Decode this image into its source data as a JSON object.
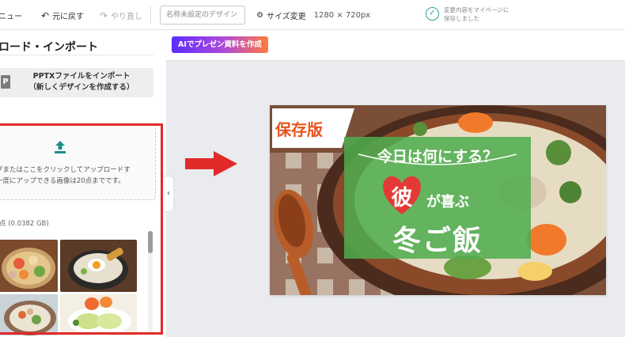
{
  "toolbar": {
    "menu_label": "ニュー",
    "undo_label": "元に戻す",
    "redo_label": "やり直し",
    "design_name_placeholder": "名称未設定のデザイン",
    "resize_label": "サイズ変更",
    "canvas_size": "1280 × 720px",
    "saved_status": "変更内容をマイページに\n保存しました"
  },
  "panel": {
    "title": "ロード・インポート",
    "pptx_icon": "P",
    "pptx_button_label": "PPTXファイルをインポート\n（新しくデザインを作成する）",
    "drop_text": "グまたはここをクリックしてアップロードす\n一度にアップできる画像は20点までです。",
    "count_text": "点 (0.0382 GB)",
    "icons": {
      "upload": "upload-icon",
      "collapse": "chevron-left-icon",
      "pptx": "pptx-file-icon"
    }
  },
  "canvas": {
    "ai_button_label": "AIでプレゼン資料を作成",
    "collapse_glyph": "‹"
  },
  "design": {
    "tag_text": "保存版",
    "line1": "今日は何にする？",
    "heart_char": "彼",
    "line2": "が喜ぶ",
    "line3": "冬ご飯"
  },
  "colors": {
    "accent_red": "#e22a2a",
    "tag_orange": "#e8541d",
    "panel_green": "#4eac4e",
    "heart_red": "#e53935",
    "saved_teal": "#2aa39a"
  }
}
